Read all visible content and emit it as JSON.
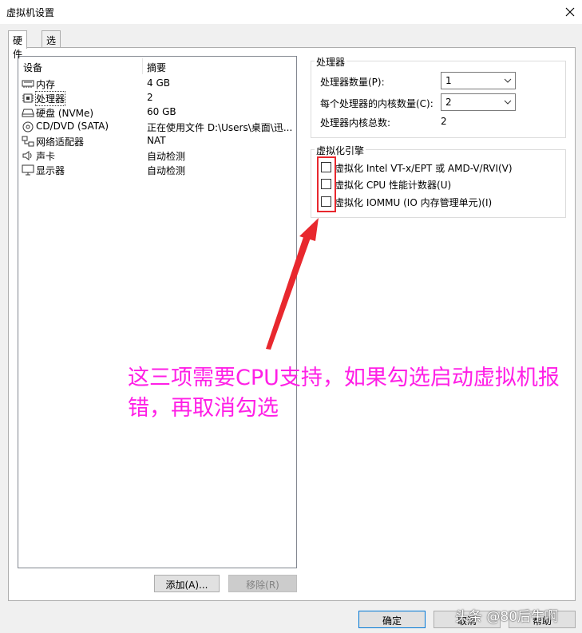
{
  "window": {
    "title": "虚拟机设置"
  },
  "tabs": [
    {
      "label": "硬件"
    },
    {
      "label": "选项"
    }
  ],
  "device_list": {
    "headers": {
      "device": "设备",
      "summary": "摘要"
    },
    "rows": [
      {
        "name": "内存",
        "summary": "4 GB",
        "icon": "memory-icon"
      },
      {
        "name": "处理器",
        "summary": "2",
        "icon": "processor-icon"
      },
      {
        "name": "硬盘 (NVMe)",
        "summary": "60 GB",
        "icon": "harddisk-icon"
      },
      {
        "name": "CD/DVD (SATA)",
        "summary": "正在使用文件 D:\\Users\\桌面\\迅...",
        "icon": "cd-icon"
      },
      {
        "name": "网络适配器",
        "summary": "NAT",
        "icon": "network-icon"
      },
      {
        "name": "声卡",
        "summary": "自动检测",
        "icon": "sound-icon"
      },
      {
        "name": "显示器",
        "summary": "自动检测",
        "icon": "display-icon"
      }
    ],
    "selected": "处理器"
  },
  "buttons": {
    "add": "添加(A)...",
    "remove": "移除(R)",
    "ok": "确定",
    "cancel": "取消",
    "help": "帮助"
  },
  "processor": {
    "legend": "处理器",
    "count_label": "处理器数量(P):",
    "count_value": "1",
    "cores_label": "每个处理器的内核数量(C):",
    "cores_value": "2",
    "total_label": "处理器内核总数:",
    "total_value": "2"
  },
  "virtualization": {
    "legend": "虚拟化引擎",
    "options": [
      {
        "label": "虚拟化 Intel VT-x/EPT 或 AMD-V/RVI(V)",
        "checked": false
      },
      {
        "label": "虚拟化 CPU 性能计数器(U)",
        "checked": false
      },
      {
        "label": "虚拟化 IOMMU (IO 内存管理单元)(I)",
        "checked": false
      }
    ]
  },
  "annotation": {
    "text": "这三项需要CPU支持，如果勾选启动虚拟机报错，再取消勾选",
    "color": "#ff1fe6",
    "arrow_color": "#e8282e"
  },
  "watermark": "头条 @80后牛啊"
}
